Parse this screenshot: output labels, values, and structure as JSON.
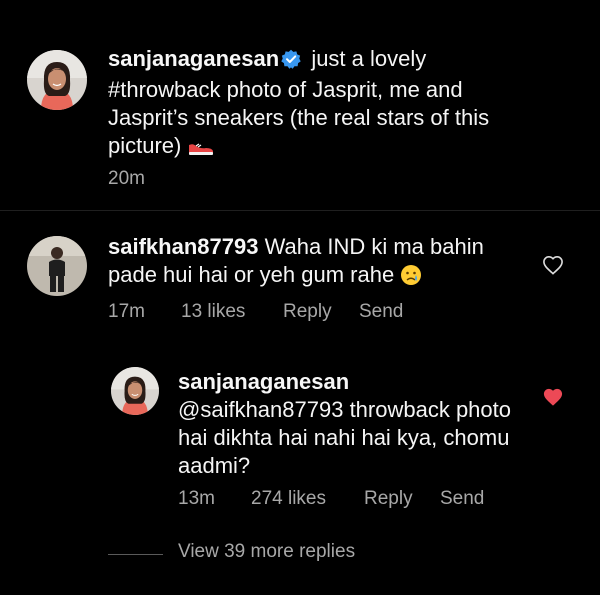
{
  "caption": {
    "username": "sanjanaganesan",
    "text": "just a lovely #throwback photo of Jasprit, me and Jasprit’s sneakers (the real stars of this picture)",
    "time": "20m"
  },
  "comments": [
    {
      "username": "saifkhan87793",
      "text": "Waha IND ki ma bahin pade hui hai or yeh gum rahe",
      "time": "17m",
      "likes": "13 likes",
      "reply_label": "Reply",
      "send_label": "Send",
      "liked": false
    }
  ],
  "replies": [
    {
      "username": "sanjanaganesan",
      "text": "@saifkhan87793 throwback photo hai dikhta hai nahi hai kya, chomu aadmi?",
      "time": "13m",
      "likes": "274 likes",
      "reply_label": "Reply",
      "send_label": "Send",
      "liked": true
    }
  ],
  "view_more_label": "View 39 more replies",
  "colors": {
    "background": "#000000",
    "text": "#f5f5f5",
    "secondary": "#a8a8a8",
    "verified": "#3897f0",
    "liked_heart": "#ed4956"
  }
}
